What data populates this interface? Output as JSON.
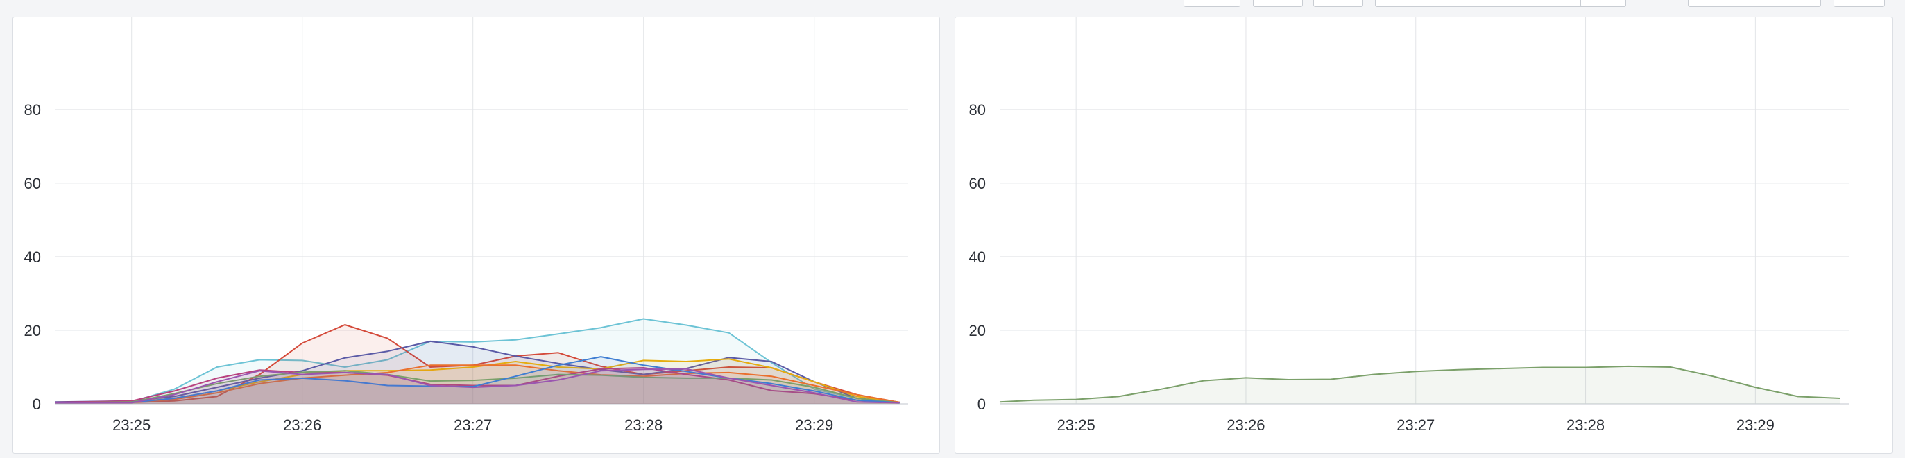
{
  "colors": {
    "grid": "#e2e4e8",
    "axis": "#d6d9de",
    "axis_text": "#2b2f36",
    "panel_border": "#dcdfe4",
    "background": "#f4f5f7"
  },
  "chart_data": [
    {
      "type": "area",
      "title": "",
      "xlabel": "",
      "ylabel": "",
      "x": [
        "23:24:33",
        "23:25:00",
        "23:25:15",
        "23:25:30",
        "23:25:45",
        "23:26:00",
        "23:26:15",
        "23:26:30",
        "23:26:45",
        "23:27:00",
        "23:27:15",
        "23:27:30",
        "23:27:45",
        "23:28:00",
        "23:28:15",
        "23:28:30",
        "23:28:45",
        "23:29:00",
        "23:29:15",
        "23:29:30"
      ],
      "xticks": [
        "23:25",
        "23:26",
        "23:27",
        "23:28",
        "23:29"
      ],
      "yticks": [
        0,
        20,
        40,
        60,
        80
      ],
      "xlim": [
        "23:24:33",
        "23:29:33"
      ],
      "ylim": [
        0,
        96
      ],
      "grid": true,
      "legend": "none",
      "series": [
        {
          "color": "#6cc3d5",
          "values": [
            0.4,
            0.6,
            4.0,
            10.0,
            12.0,
            11.8,
            10.0,
            12.0,
            17.0,
            16.8,
            17.4,
            19.0,
            20.7,
            23.1,
            21.4,
            19.3,
            11.2,
            4.0,
            1.5,
            0.4
          ]
        },
        {
          "color": "#d44a3a",
          "values": [
            0.3,
            0.4,
            0.8,
            2.0,
            8.0,
            16.5,
            21.5,
            17.8,
            10.0,
            10.5,
            13.0,
            13.9,
            10.2,
            8.0,
            9.0,
            10.0,
            9.8,
            6.0,
            2.5,
            0.4
          ]
        },
        {
          "color": "#5a5aa6",
          "values": [
            0.5,
            0.8,
            2.0,
            4.5,
            7.0,
            9.0,
            12.5,
            14.3,
            17.0,
            15.5,
            13.0,
            11.0,
            9.3,
            8.0,
            9.6,
            12.6,
            11.5,
            6.0,
            1.5,
            0.4
          ]
        },
        {
          "color": "#e5ac0e",
          "values": [
            0.3,
            0.5,
            1.5,
            3.5,
            6.0,
            8.0,
            9.0,
            9.0,
            9.2,
            10.0,
            11.5,
            10.0,
            9.5,
            11.8,
            11.5,
            12.2,
            9.8,
            6.0,
            2.0,
            0.4
          ]
        },
        {
          "color": "#ea6f2d",
          "values": [
            0.3,
            0.5,
            1.2,
            3.0,
            5.5,
            7.0,
            7.8,
            8.5,
            10.5,
            10.5,
            10.5,
            9.0,
            7.9,
            7.5,
            8.3,
            8.5,
            7.5,
            5.0,
            2.5,
            0.4
          ]
        },
        {
          "color": "#b8417e",
          "values": [
            0.4,
            0.8,
            3.5,
            7.0,
            9.2,
            8.5,
            8.5,
            7.8,
            5.3,
            5.0,
            5.0,
            7.5,
            9.5,
            9.8,
            8.0,
            6.5,
            3.6,
            2.8,
            1.0,
            0.3
          ]
        },
        {
          "color": "#7ba06a",
          "values": [
            0.3,
            0.5,
            2.8,
            5.5,
            7.5,
            8.6,
            9.0,
            8.0,
            6.2,
            6.4,
            7.0,
            8.0,
            7.8,
            7.2,
            7.0,
            7.0,
            6.5,
            4.5,
            1.5,
            0.3
          ]
        },
        {
          "color": "#3e7dd2",
          "values": [
            0.3,
            0.4,
            1.5,
            3.5,
            6.5,
            7.0,
            6.3,
            5.0,
            4.8,
            4.7,
            7.5,
            10.5,
            12.8,
            10.5,
            8.8,
            7.0,
            5.5,
            3.5,
            1.0,
            0.3
          ]
        },
        {
          "color": "#9a55b0",
          "values": [
            0.3,
            0.3,
            2.5,
            6.0,
            9.0,
            8.0,
            8.5,
            8.0,
            5.0,
            4.5,
            5.0,
            6.5,
            9.0,
            9.4,
            9.5,
            7.0,
            5.0,
            3.0,
            0.5,
            0.3
          ]
        }
      ]
    },
    {
      "type": "area",
      "title": "",
      "xlabel": "",
      "ylabel": "",
      "x": [
        "23:24:33",
        "23:24:45",
        "23:25:00",
        "23:25:15",
        "23:25:30",
        "23:25:45",
        "23:26:00",
        "23:26:15",
        "23:26:30",
        "23:26:45",
        "23:27:00",
        "23:27:15",
        "23:27:30",
        "23:27:45",
        "23:28:00",
        "23:28:15",
        "23:28:30",
        "23:28:45",
        "23:29:00",
        "23:29:15",
        "23:29:30"
      ],
      "xticks": [
        "23:25",
        "23:26",
        "23:27",
        "23:28",
        "23:29"
      ],
      "yticks": [
        0,
        20,
        40,
        60,
        80
      ],
      "xlim": [
        "23:24:33",
        "23:29:33"
      ],
      "ylim": [
        0,
        96
      ],
      "grid": true,
      "legend": "none",
      "series": [
        {
          "color": "#7ba06a",
          "values": [
            0.5,
            1.0,
            1.2,
            2.0,
            4.0,
            6.3,
            7.1,
            6.6,
            6.7,
            8.0,
            8.8,
            9.3,
            9.6,
            9.9,
            9.9,
            10.2,
            10.0,
            7.5,
            4.5,
            2.0,
            1.5
          ]
        }
      ]
    }
  ]
}
